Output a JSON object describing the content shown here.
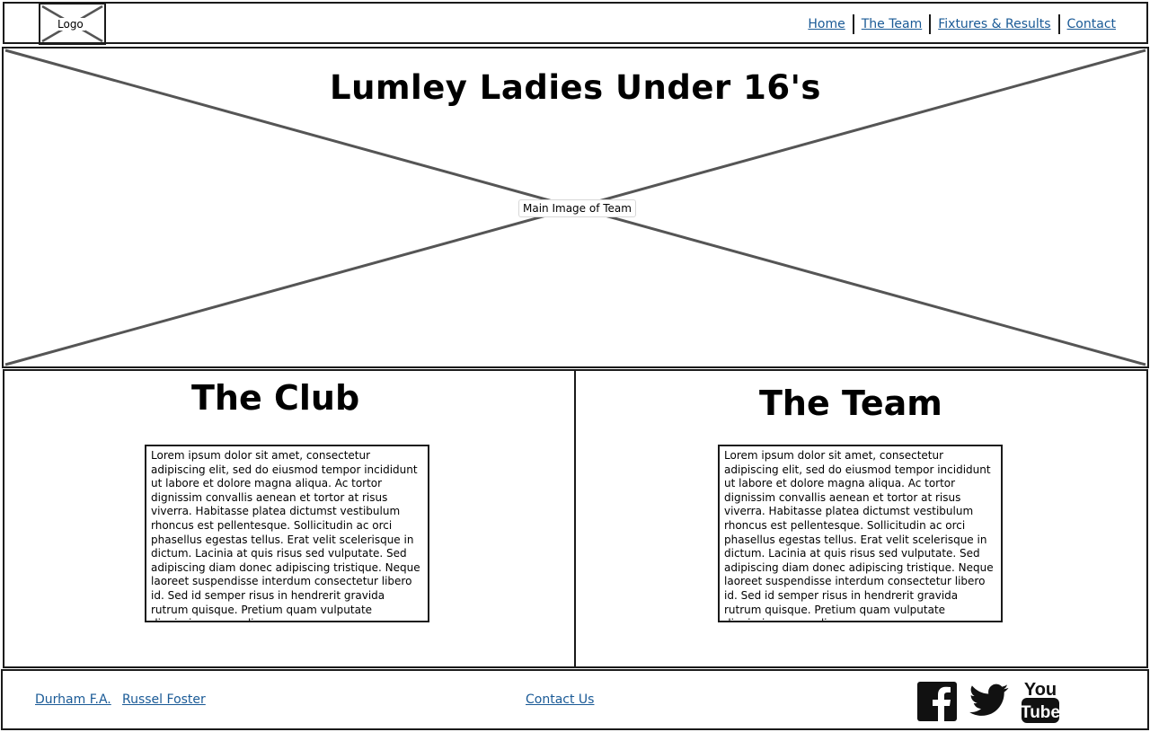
{
  "header": {
    "logo_label": "Logo",
    "nav": [
      {
        "label": "Home"
      },
      {
        "label": "The Team"
      },
      {
        "label": "Fixtures & Results"
      },
      {
        "label": "Contact"
      }
    ]
  },
  "hero": {
    "title": "Lumley Ladies Under 16's",
    "image_label": "Main Image of Team"
  },
  "club": {
    "title": "The Club",
    "body": "Lorem ipsum dolor sit amet, consectetur adipiscing elit, sed do eiusmod tempor incididunt ut labore et dolore magna aliqua. Ac tortor dignissim convallis aenean et tortor at risus viverra. Habitasse platea dictumst vestibulum rhoncus est pellentesque. Sollicitudin ac orci phasellus egestas tellus. Erat velit scelerisque in dictum. Lacinia at quis risus sed vulputate. Sed adipiscing diam donec adipiscing tristique. Neque laoreet suspendisse interdum consectetur libero id. Sed id semper risus in hendrerit gravida rutrum quisque. Pretium quam vulputate dignissim suspendisse."
  },
  "team": {
    "title": "The Team",
    "body": "Lorem ipsum dolor sit amet, consectetur adipiscing elit, sed do eiusmod tempor incididunt ut labore et dolore magna aliqua. Ac tortor dignissim convallis aenean et tortor at risus viverra. Habitasse platea dictumst vestibulum rhoncus est pellentesque. Sollicitudin ac orci phasellus egestas tellus. Erat velit scelerisque in dictum. Lacinia at quis risus sed vulputate. Sed adipiscing diam donec adipiscing tristique. Neque laoreet suspendisse interdum consectetur libero id. Sed id semper risus in hendrerit gravida rutrum quisque. Pretium quam vulputate dignissim suspendisse."
  },
  "footer": {
    "links": [
      {
        "label": "Durham F.A."
      },
      {
        "label": "Russel Foster"
      }
    ],
    "contact_label": "Contact Us",
    "social_icons": [
      "facebook-icon",
      "twitter-icon",
      "youtube-icon"
    ]
  },
  "colors": {
    "link": "#1a5a96",
    "border": "#1a1a1a",
    "placeholder_cross": "#555555"
  }
}
